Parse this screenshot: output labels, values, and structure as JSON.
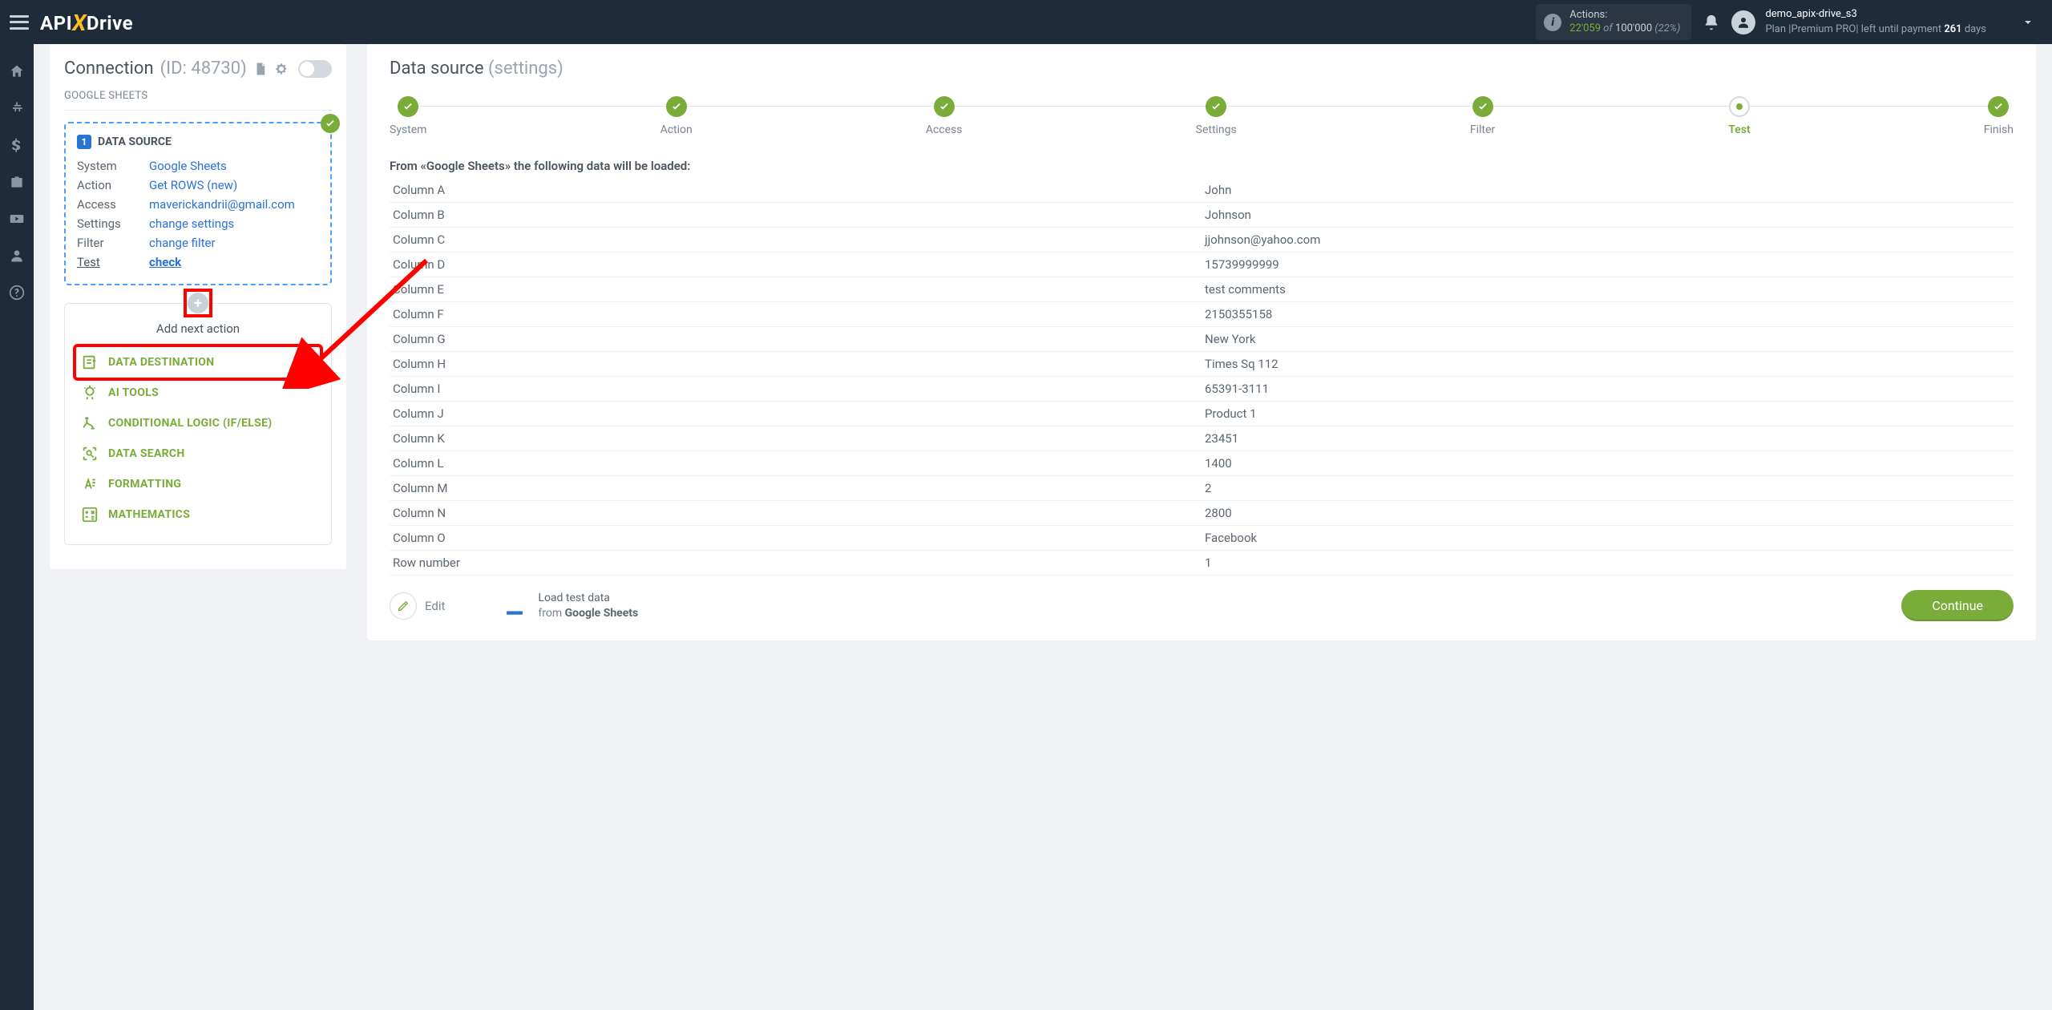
{
  "header": {
    "logo_api": "API",
    "logo_drive": "Drive",
    "actions_label": "Actions:",
    "actions_current": "22'059",
    "actions_of": " of ",
    "actions_total": "100'000",
    "actions_pct": " (22%)",
    "user_name": "demo_apix-drive_s3",
    "plan_prefix": "Plan |Premium PRO| left until payment ",
    "plan_days": "261",
    "plan_suffix": " days"
  },
  "connection": {
    "title": "Connection",
    "id_label": "(ID: 48730)",
    "source_label": "GOOGLE SHEETS",
    "ds_badge": "1",
    "ds_title": "DATA SOURCE",
    "rows": {
      "system_l": "System",
      "system_v": "Google Sheets",
      "action_l": "Action",
      "action_v": "Get ROWS (new)",
      "access_l": "Access",
      "access_v": "maverickandrii@gmail.com",
      "settings_l": "Settings",
      "settings_v": "change settings",
      "filter_l": "Filter",
      "filter_v": "change filter",
      "test_l": "Test",
      "test_v": "check"
    }
  },
  "actions": {
    "title": "Add next action",
    "items": [
      "DATA DESTINATION",
      "AI TOOLS",
      "CONDITIONAL LOGIC (IF/ELSE)",
      "DATA SEARCH",
      "FORMATTING",
      "MATHEMATICS"
    ]
  },
  "main": {
    "title": "Data source",
    "subtitle": "(settings)",
    "steps": [
      "System",
      "Action",
      "Access",
      "Settings",
      "Filter",
      "Test",
      "Finish"
    ],
    "load_desc": "From «Google Sheets» the following data will be loaded:",
    "table": [
      [
        "Column A",
        "John"
      ],
      [
        "Column B",
        "Johnson"
      ],
      [
        "Column C",
        "jjohnson@yahoo.com"
      ],
      [
        "Column D",
        "15739999999"
      ],
      [
        "Column E",
        "test comments"
      ],
      [
        "Column F",
        "2150355158"
      ],
      [
        "Column G",
        "New York"
      ],
      [
        "Column H",
        "Times Sq 112"
      ],
      [
        "Column I",
        "65391-3111"
      ],
      [
        "Column J",
        "Product 1"
      ],
      [
        "Column K",
        "23451"
      ],
      [
        "Column L",
        "1400"
      ],
      [
        "Column M",
        "2"
      ],
      [
        "Column N",
        "2800"
      ],
      [
        "Column O",
        "Facebook"
      ],
      [
        "Row number",
        "1"
      ]
    ],
    "edit_label": "Edit",
    "load_test_l1": "Load test data",
    "load_test_l2a": "from ",
    "load_test_l2b": "Google Sheets",
    "continue": "Continue"
  }
}
